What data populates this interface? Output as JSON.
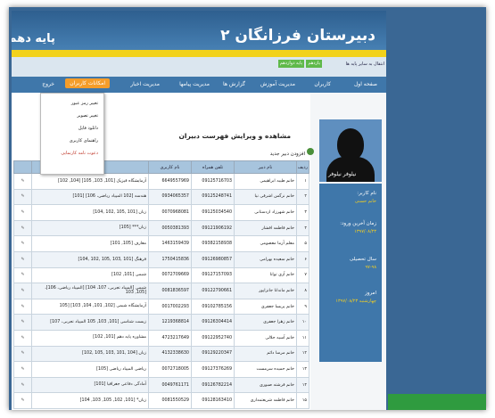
{
  "site": {
    "title": "دبیرستان فرزانگان ۲",
    "grade": "پایه دهم"
  },
  "subbar": {
    "switch_text": "انتقال به سایر پایه ها",
    "grade11": "یازدهم",
    "grade10": "پایه دوازدهم"
  },
  "nav": [
    "صفحه اول",
    "کاربران",
    "مدیریت آموزش",
    "گزارش ها",
    "مدیریت پیامها",
    "مدیریت اخبار",
    "امکانات کاربران",
    "خروج"
  ],
  "dropdown": [
    "تغییر رمز عبور",
    "تغییر تصویر",
    "دانلود فایل",
    "راهنمای کاربری",
    "دعوت نامه کارنمایی"
  ],
  "content": {
    "title": "مشاهده و ویرایش فهرست دبیران",
    "add_link": "افزودن دبیر جدید"
  },
  "table": {
    "headers": [
      "ردیف",
      "نام دبیر",
      "تلفن همراه",
      "نام کاربری",
      "دروس ها",
      ""
    ],
    "rows": [
      [
        "۱",
        "خانم طیبه ابراهیمی",
        "09125716703",
        "6649557969",
        "آزمایشگاه فیزیک [101, 103, 105] [104, 102]"
      ],
      [
        "۲",
        "خانم نرگس اشرفی نیا",
        "09125248741",
        "0934065357",
        "هندسه [102 المپیاد ریاضی، 106] [101]"
      ],
      [
        "۳",
        "خانم شهرزاد اردستانی",
        "09125034540",
        "0070968081",
        "[104, 102, 105, 101] زبان"
      ],
      [
        "۴",
        "خانم فاطمه افشار",
        "09121906192",
        "0050381393",
        "زبان*** [105]"
      ],
      [
        "۵",
        "معلم آزما معصومی",
        "09382158938",
        "1463159439",
        "معارف [105, 101]"
      ],
      [
        "۶",
        "خانم سعیده بهرامی",
        "09126980857",
        "1750415836",
        "[104, 102, 105, 103, 101] فرهنگ"
      ],
      [
        "۷",
        "خانم آری توانا",
        "09127157093",
        "0072709669",
        "شیمی [101, 102]"
      ],
      [
        "۸",
        "خانم ماندانا جانزاپور",
        "09122790661",
        "0081836597",
        "شیمی [المپیاد تجربی، 107، 104] [المپیاد ریاضی، 106]، [105, 103"
      ],
      [
        "۹",
        "خانم پریسا جعفری",
        "09102785156",
        "0017002293",
        "آزمایشگاه شیمی [102, 101, 104, 103] [105"
      ],
      [
        "۱۰",
        "خانم زهرا جعفری",
        "09126304414",
        "1219368814",
        "زیست شناسی [101, 103, 105 المپیاد تجربی، 107]"
      ],
      [
        "۱۱",
        "خانم آسیه جلالی",
        "09122952740",
        "4723217649",
        "مشاوره پایه دهم [101, 102]"
      ],
      [
        "۱۲",
        "خانم مرسا دائم",
        "09129220347",
        "4132338630",
        "[102, 105, 103, 101, 104] زبان"
      ],
      [
        "۱۳",
        "خانم حمیده سرمست",
        "09127376269",
        "0072718005",
        "ریاضی المپیاد ریاضی [105]"
      ],
      [
        "۱۴",
        "خانم فرشته صبوری",
        "09126782214",
        "0049761171",
        "آمادگی دفاعی جغرافیا [101]"
      ],
      [
        "۱۵",
        "خانم فاطمه شریعتمداری",
        "09128163410",
        "0081550529",
        "زبان* [101, 102, 105, 103, 104]"
      ]
    ]
  },
  "sidebar": {
    "name_caption": "نیلوفر نیلوفر",
    "username_label": "نام کاربر:",
    "username_value": "خانم حسنی",
    "last_login_label": "زمان آخرین ورود:",
    "last_login_value": "۱۳۹۷/۰۸/۲۳",
    "year_label": "سال تحصیلی",
    "year_value": "۹۷-۹۸",
    "today_label": "امروز",
    "today_value": "چهارشنبه ۱۳۹۷/۰۸/۲۳"
  },
  "colors": {
    "frame": "#3a6794",
    "nav": "#3f77aa",
    "active_nav": "#f59d2a",
    "accent_yellow": "#f2d21b",
    "header_row": "#a7c4dd"
  }
}
